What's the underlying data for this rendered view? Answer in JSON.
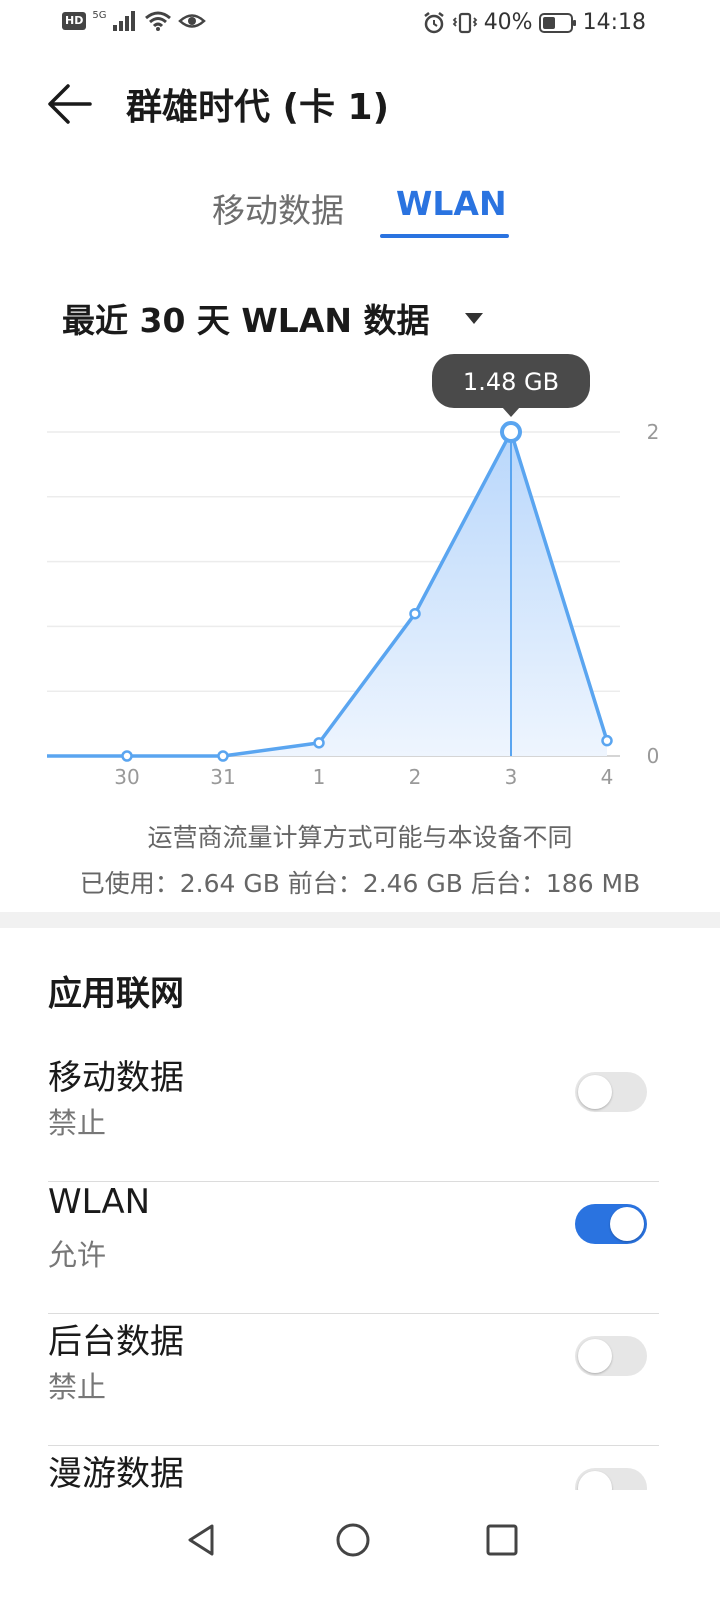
{
  "status_bar": {
    "network_badge": "HD",
    "network_gen": "5G",
    "battery_percent": "40%",
    "time": "14:18"
  },
  "header": {
    "title": "群雄时代 (卡 1)"
  },
  "tabs": [
    {
      "label": "移动数据",
      "selected": false
    },
    {
      "label": "WLAN",
      "selected": true
    }
  ],
  "period_selector": {
    "label": "最近 30 天 WLAN 数据"
  },
  "chart_data": {
    "type": "area",
    "x": [
      "30",
      "31",
      "1",
      "2",
      "3",
      "4"
    ],
    "values": [
      0,
      0,
      0.06,
      0.65,
      1.48,
      0.07
    ],
    "ylim": [
      0,
      1.48
    ],
    "y_tick_labels": [
      "2",
      "0"
    ],
    "grid": true,
    "selected_index": 4,
    "tooltip": "1.48 GB",
    "colors": {
      "line": "#5aa5f0",
      "fill_top": "#b9d7fb",
      "fill_bottom": "#eef5fe",
      "tooltip_bg": "#4a4a4a"
    }
  },
  "usage_note": {
    "line1": "运营商流量计算方式可能与本设备不同",
    "line2": "已使用：2.64 GB  前台：2.46 GB  后台：186 MB"
  },
  "app_network": {
    "title": "应用联网",
    "items": [
      {
        "label": "移动数据",
        "status": "禁止",
        "enabled": false
      },
      {
        "label": "WLAN",
        "status": "允许",
        "enabled": true
      },
      {
        "label": "后台数据",
        "status": "禁止",
        "enabled": false
      },
      {
        "label": "漫游数据",
        "status": "",
        "enabled": false
      }
    ]
  },
  "icons": {
    "back": "arrow-left-icon",
    "dropdown": "caret-down-icon",
    "nav_back": "triangle-back-icon",
    "nav_home": "circle-home-icon",
    "nav_recents": "square-recents-icon"
  },
  "colors": {
    "accent": "#2a73e0",
    "toggle_off": "#e6e6e6"
  }
}
